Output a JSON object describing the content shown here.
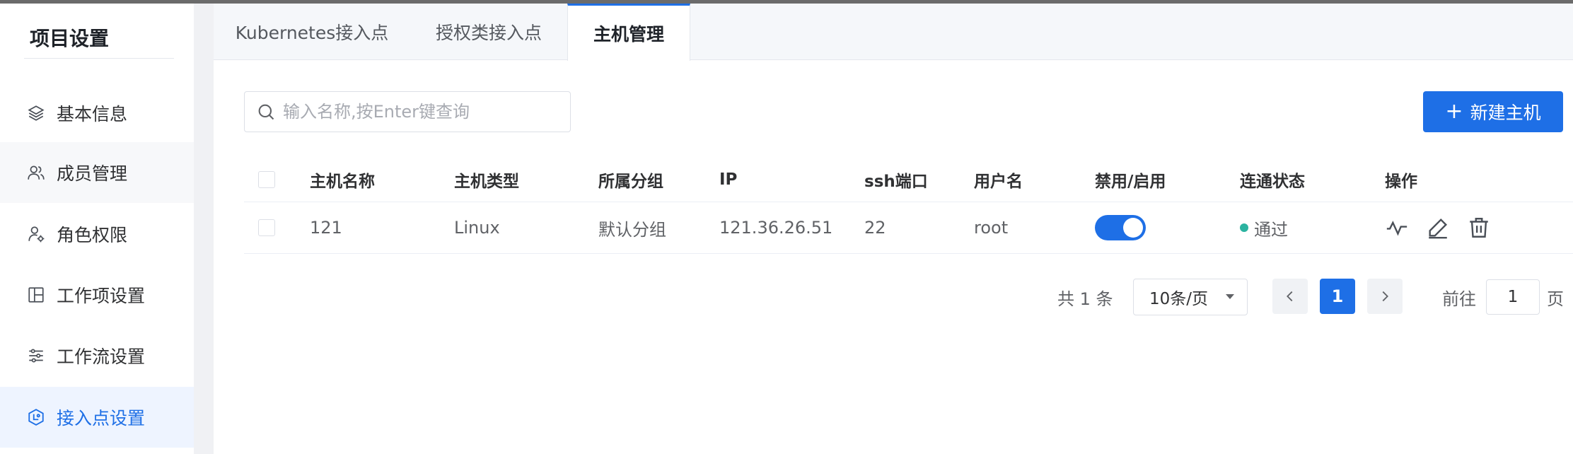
{
  "sidebar": {
    "title": "项目设置",
    "items": [
      {
        "label": "基本信息",
        "icon": "layers-icon"
      },
      {
        "label": "成员管理",
        "icon": "users-icon"
      },
      {
        "label": "角色权限",
        "icon": "user-settings-icon"
      },
      {
        "label": "工作项设置",
        "icon": "layout-grid-icon"
      },
      {
        "label": "工作流设置",
        "icon": "sliders-icon"
      },
      {
        "label": "接入点设置",
        "icon": "hexagon-link-icon"
      }
    ],
    "active_item": "接入点设置",
    "accent_color": "#1e6fe6"
  },
  "tabs": [
    {
      "label": "Kubernetes接入点"
    },
    {
      "label": "授权类接入点"
    },
    {
      "label": "主机管理"
    }
  ],
  "active_tab": "主机管理",
  "search": {
    "placeholder": "输入名称,按Enter键查询",
    "value": ""
  },
  "new_button": {
    "label": "新建主机",
    "icon": "plus-icon"
  },
  "table": {
    "columns": [
      "主机名称",
      "主机类型",
      "所属分组",
      "IP",
      "ssh端口",
      "用户名",
      "禁用/启用",
      "连通状态",
      "操作"
    ],
    "rows": [
      {
        "name": "121",
        "type": "Linux",
        "group": "默认分组",
        "ip": "121.36.26.51",
        "port": "22",
        "user": "root",
        "enabled": true,
        "status": "通过",
        "status_color": "#2bb3a0",
        "actions": [
          "activity-icon",
          "edit-icon",
          "trash-icon"
        ]
      }
    ]
  },
  "pagination": {
    "total": "共 1 条",
    "page_size": "10条/页",
    "current_page": "1",
    "goto_label": "前往",
    "goto_value": "1",
    "page_unit": "页"
  }
}
